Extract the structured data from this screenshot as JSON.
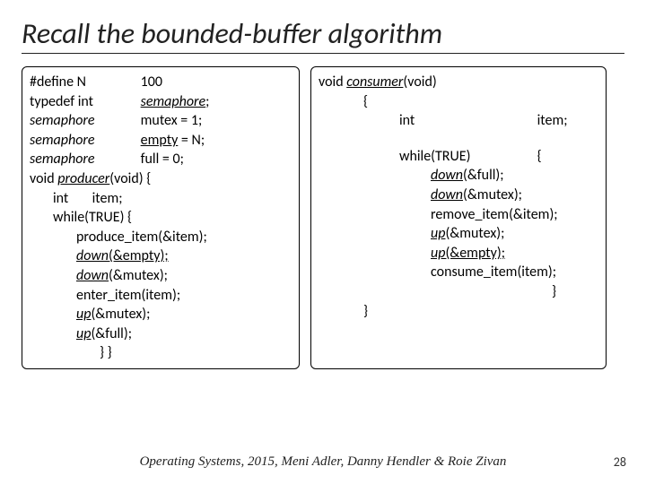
{
  "title": "Recall the bounded-buffer algorithm",
  "left": {
    "l1a": "#define   N",
    "l1b": "100",
    "l2a": "typedef   int",
    "l2b": "semaphore",
    "l2c": ";",
    "l3a": "semaphore",
    "l3b": "mutex = 1;",
    "l4a": "semaphore",
    "l4b": "empty",
    "l4c": " = N;",
    "l5a": "semaphore",
    "l5b": "full = 0;",
    "l6a": "void ",
    "l6b": "producer",
    "l6c": "(void) {",
    "l7a": "int",
    "l7b": "item;",
    "l8": "while(TRUE) {",
    "l9": "produce_item(&item);",
    "l10a": "down",
    "l10b": "(&empty);",
    "l11a": "down",
    "l11b": "(&mutex);",
    "l12": "enter_item(item);",
    "l13a": "up",
    "l13b": "(&mutex);",
    "l14a": "up",
    "l14b": "(&full);",
    "l15": "}            }"
  },
  "right": {
    "l1a": "void ",
    "l1b": "consumer",
    "l1c": "(void)",
    "l2": "{",
    "l3a": "int",
    "l3b": "item;",
    "l4a": "while(TRUE)",
    "l4b": "{",
    "l5a": "down",
    "l5b": "(&full);",
    "l6a": "down",
    "l6b": "(&mutex);",
    "l7": "remove_item(&item);",
    "l8a": "up",
    "l8b": "(&mutex);",
    "l9a": "up",
    "l9b": "(&empty);",
    "l10": "consume_item(item);",
    "l11": "}",
    "l12": "}"
  },
  "footer": "Operating Systems, 2015, Meni Adler, Danny Hendler & Roie Zivan",
  "page": "28"
}
